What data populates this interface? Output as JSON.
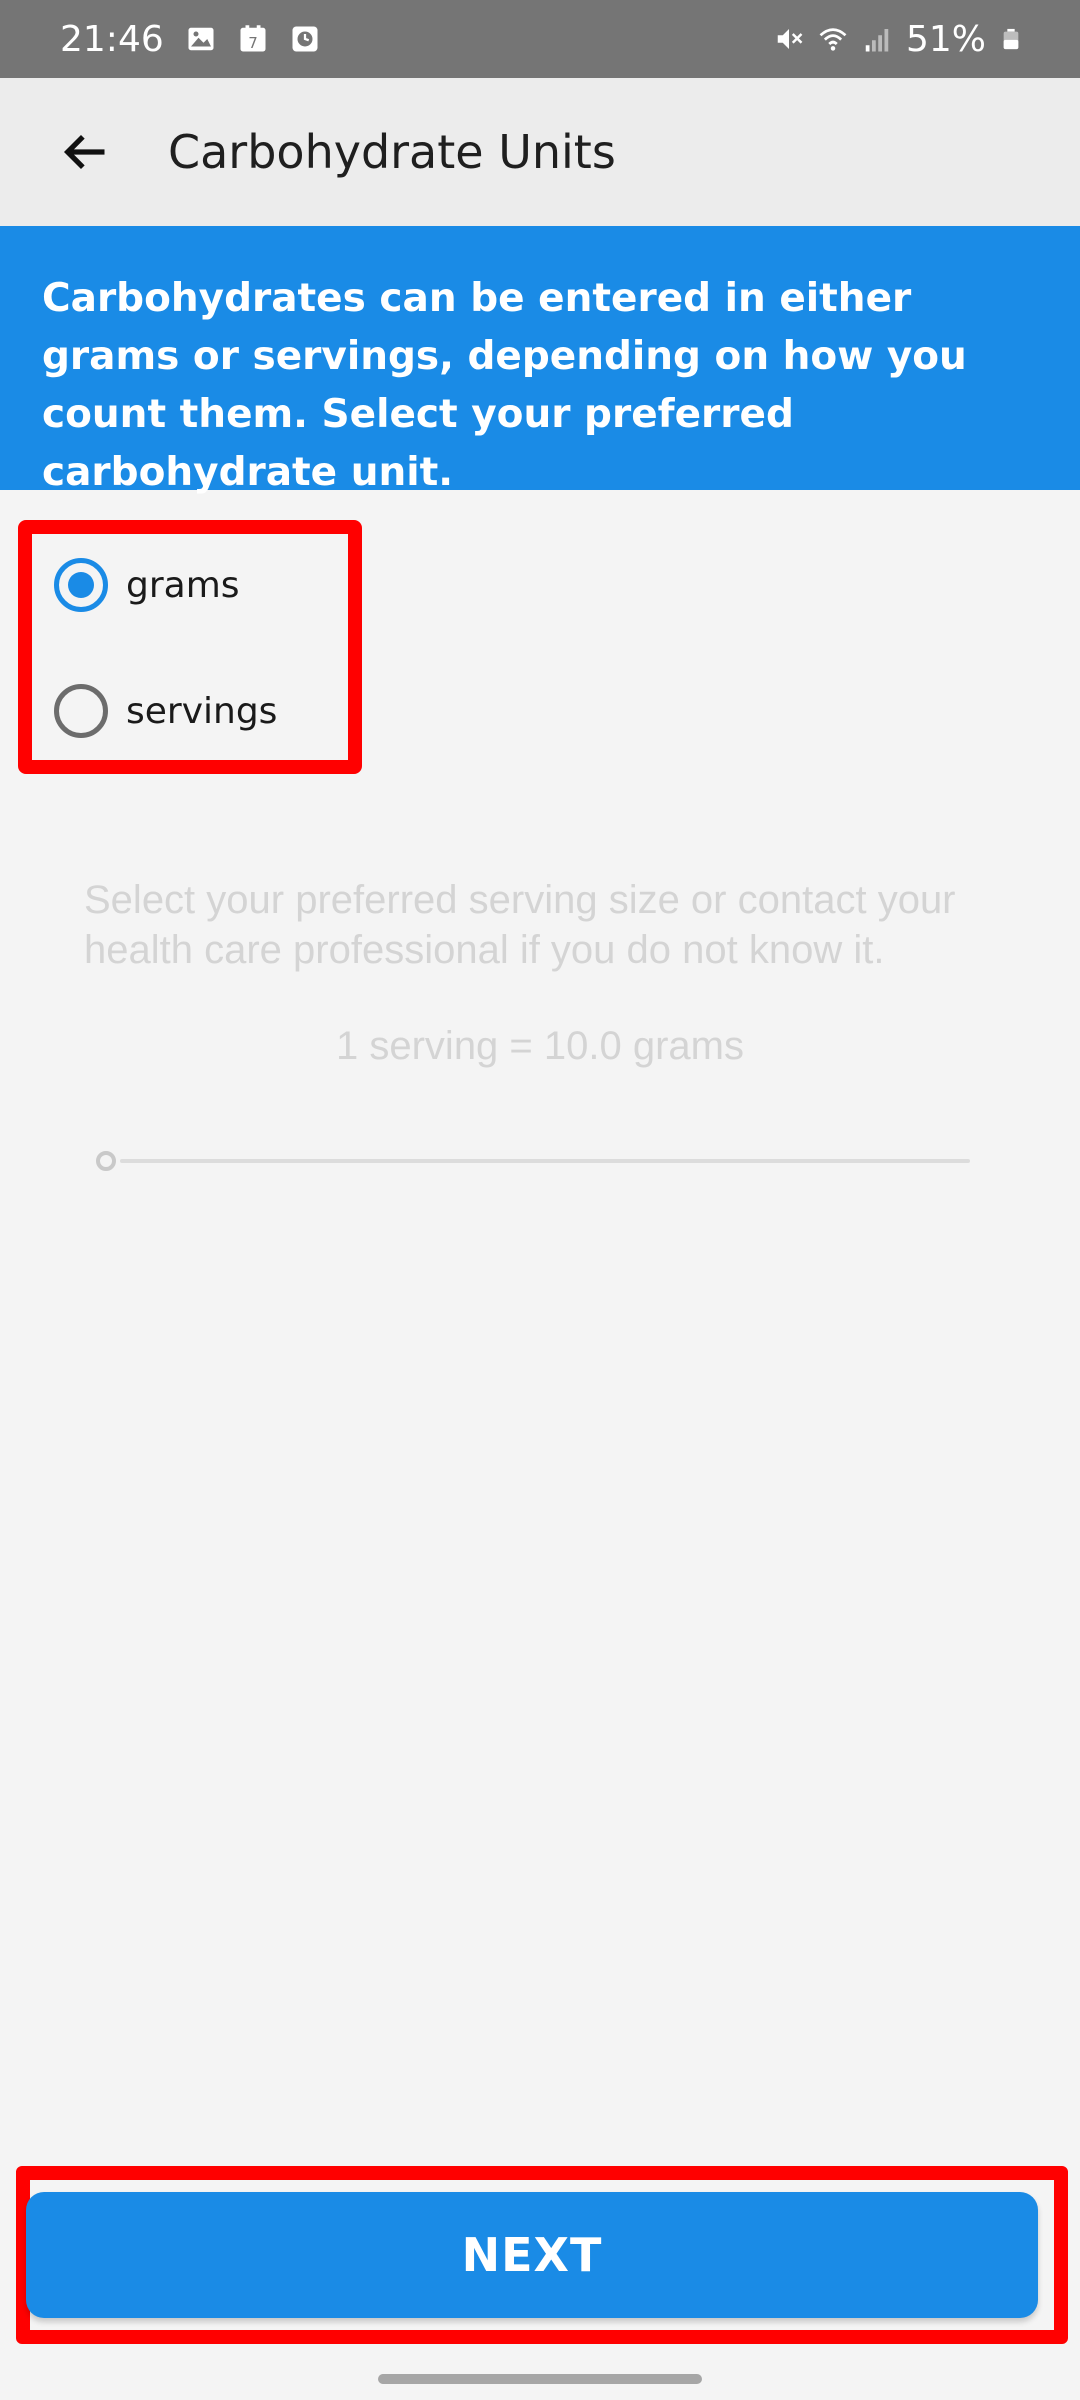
{
  "status_bar": {
    "time": "21:46",
    "left_icons": [
      "gallery-icon",
      "calendar-icon",
      "clock-icon"
    ],
    "calendar_day": "7",
    "right_icons": [
      "mute-icon",
      "wifi-icon",
      "signal-icon",
      "battery-icon"
    ],
    "battery_percent": "51%"
  },
  "app_bar": {
    "back_icon": "arrow-left-icon",
    "title": "Carbohydrate Units"
  },
  "info_banner": {
    "text": "Carbohydrates can be entered in either grams or servings, depending on how you count them. Select your preferred carbohydrate unit."
  },
  "unit_options": {
    "selected": "grams",
    "items": [
      {
        "label": "grams",
        "checked": true
      },
      {
        "label": "servings",
        "checked": false
      }
    ]
  },
  "serving": {
    "hint": "Select your preferred serving size or contact your health care professional if you do not know it.",
    "value_text": "1 serving = 10.0 grams",
    "slider_fraction": 0.0,
    "enabled": false
  },
  "next_button": {
    "label": "NEXT"
  },
  "colors": {
    "accent": "#1a8be6",
    "highlight_frame": "#ff0000",
    "status_bar": "#757575",
    "app_bar": "#ececec",
    "background": "#f4f4f4",
    "disabled_text": "#d4d4d4"
  }
}
